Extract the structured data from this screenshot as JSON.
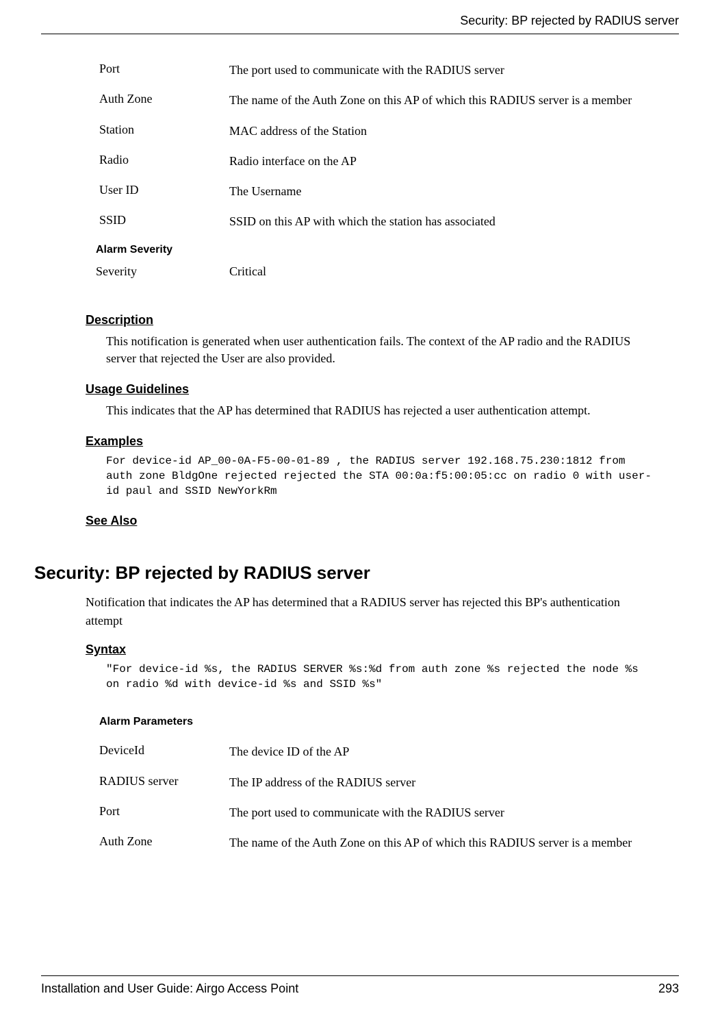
{
  "header": {
    "title": "Security: BP rejected by RADIUS server"
  },
  "top_params": [
    {
      "label": "Port",
      "desc": "The port used to communicate with the RADIUS server"
    },
    {
      "label": "Auth Zone",
      "desc": "The name of the Auth Zone on this AP of which this RADIUS server  is a member"
    },
    {
      "label": "Station",
      "desc": "MAC address of the Station"
    },
    {
      "label": "Radio",
      "desc": "Radio interface on the AP"
    },
    {
      "label": "User ID",
      "desc": "The Username"
    },
    {
      "label": "SSID",
      "desc": " SSID on this AP with which the station has associated"
    }
  ],
  "alarm_severity": {
    "header": "Alarm Severity",
    "label": "Severity",
    "value": "Critical"
  },
  "sections": {
    "description": {
      "heading": "Description",
      "body": "This notification is generated when user authentication fails. The context of the AP radio and the RADIUS server that rejected the User are also provided."
    },
    "usage": {
      "heading": "Usage Guidelines",
      "body": "This indicates that the AP has determined that RADIUS has rejected a user authentication attempt."
    },
    "examples": {
      "heading": "Examples",
      "code": "For device-id AP_00-0A-F5-00-01-89 , the RADIUS server 192.168.75.230:1812 from auth zone BldgOne rejected rejected the STA 00:0a:f5:00:05:cc on radio 0 with user-id paul and SSID NewYorkRm"
    },
    "see_also": {
      "heading": "See Also"
    }
  },
  "main_section": {
    "heading": "Security: BP rejected by RADIUS server",
    "body": "Notification that indicates the AP has determined that a RADIUS server has rejected this BP's authentication attempt",
    "syntax_heading": "Syntax",
    "syntax_code": "\"For device-id %s, the RADIUS SERVER %s:%d from auth zone %s rejected the node %s on radio %d with device-id %s and SSID %s\"",
    "alarm_params_header": "Alarm Parameters",
    "alarm_params": [
      {
        "label": "DeviceId",
        "desc": "The device ID of the AP"
      },
      {
        "label": "RADIUS server",
        "desc": "The IP address of the RADIUS server"
      },
      {
        "label": "Port",
        "desc": "The port used to communicate with the RADIUS server"
      },
      {
        "label": "Auth Zone",
        "desc": "The name of the Auth Zone on this AP of which this RADIUS server  is a member"
      }
    ]
  },
  "footer": {
    "left": "Installation and User Guide: Airgo Access Point",
    "right": "293"
  }
}
